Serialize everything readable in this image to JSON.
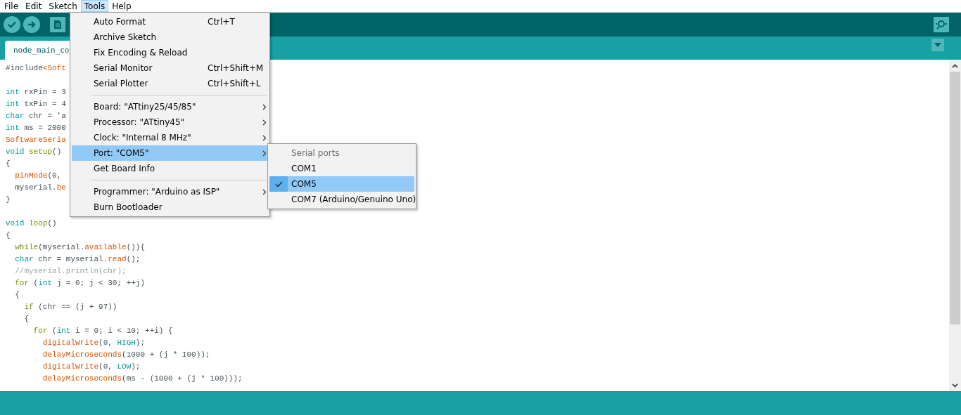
{
  "menubar": [
    {
      "label": "File",
      "selected": false
    },
    {
      "label": "Edit",
      "selected": false
    },
    {
      "label": "Sketch",
      "selected": false
    },
    {
      "label": "Tools",
      "selected": true
    },
    {
      "label": "Help",
      "selected": false
    }
  ],
  "tabs": [
    {
      "label": "node_main_co",
      "selected": true
    }
  ],
  "editor": {
    "lines": [
      {
        "kind": "code",
        "segments": [
          {
            "text": "#include",
            "kind": "plain"
          },
          {
            "text": "<Soft",
            "kind": "func"
          }
        ]
      },
      {
        "kind": "blank"
      },
      {
        "kind": "code",
        "segments": [
          {
            "text": "int",
            "kind": "type"
          },
          {
            "text": " rxPin = 3",
            "kind": "plain"
          }
        ]
      },
      {
        "kind": "code",
        "segments": [
          {
            "text": "int",
            "kind": "type"
          },
          {
            "text": " txPin = 4",
            "kind": "plain"
          }
        ]
      },
      {
        "kind": "code",
        "segments": [
          {
            "text": "char",
            "kind": "type"
          },
          {
            "text": " chr = 'a",
            "kind": "plain"
          }
        ]
      },
      {
        "kind": "code",
        "segments": [
          {
            "text": "int",
            "kind": "type"
          },
          {
            "text": " ms = 2000",
            "kind": "plain"
          }
        ]
      },
      {
        "kind": "code",
        "segments": [
          {
            "text": "SoftwareSeria",
            "kind": "func"
          }
        ]
      },
      {
        "kind": "code",
        "segments": [
          {
            "text": "void ",
            "kind": "type"
          },
          {
            "text": "setup",
            "kind": "kw"
          },
          {
            "text": "()",
            "kind": "plain"
          }
        ]
      },
      {
        "kind": "code",
        "segments": [
          {
            "text": "{",
            "kind": "plain"
          }
        ]
      },
      {
        "kind": "code",
        "segments": [
          {
            "text": "  pinMode",
            "kind": "func"
          },
          {
            "text": "(0,",
            "kind": "plain"
          }
        ]
      },
      {
        "kind": "code",
        "segments": [
          {
            "text": "  myserial.",
            "kind": "plain"
          },
          {
            "text": "be",
            "kind": "func"
          }
        ]
      },
      {
        "kind": "code",
        "segments": [
          {
            "text": "}",
            "kind": "plain"
          }
        ]
      },
      {
        "kind": "blank"
      },
      {
        "kind": "code",
        "segments": [
          {
            "text": "void ",
            "kind": "type"
          },
          {
            "text": "loop",
            "kind": "kw"
          },
          {
            "text": "()",
            "kind": "plain"
          }
        ]
      },
      {
        "kind": "code",
        "segments": [
          {
            "text": "{",
            "kind": "plain"
          }
        ]
      },
      {
        "kind": "code",
        "segments": [
          {
            "text": "  while",
            "kind": "kw"
          },
          {
            "text": "(myserial.",
            "kind": "plain"
          },
          {
            "text": "available",
            "kind": "func"
          },
          {
            "text": "()){",
            "kind": "plain"
          }
        ]
      },
      {
        "kind": "code",
        "segments": [
          {
            "text": "  char",
            "kind": "type"
          },
          {
            "text": " chr = myserial.",
            "kind": "plain"
          },
          {
            "text": "read",
            "kind": "func"
          },
          {
            "text": "();",
            "kind": "plain"
          }
        ]
      },
      {
        "kind": "code",
        "segments": [
          {
            "text": "  //myserial.println(chr);",
            "kind": "comment"
          }
        ]
      },
      {
        "kind": "code",
        "segments": [
          {
            "text": "  for",
            "kind": "kw"
          },
          {
            "text": " (",
            "kind": "plain"
          },
          {
            "text": "int",
            "kind": "type"
          },
          {
            "text": " j = 0; j < 30; ++j)",
            "kind": "plain"
          }
        ]
      },
      {
        "kind": "code",
        "segments": [
          {
            "text": "  {",
            "kind": "plain"
          }
        ]
      },
      {
        "kind": "code",
        "segments": [
          {
            "text": "    if",
            "kind": "kw"
          },
          {
            "text": " (chr == (j + 97))",
            "kind": "plain"
          }
        ]
      },
      {
        "kind": "code",
        "segments": [
          {
            "text": "    {",
            "kind": "plain"
          }
        ]
      },
      {
        "kind": "code",
        "segments": [
          {
            "text": "      for",
            "kind": "kw"
          },
          {
            "text": " (",
            "kind": "plain"
          },
          {
            "text": "int",
            "kind": "type"
          },
          {
            "text": " i = 0; i < 10; ++i) {",
            "kind": "plain"
          }
        ]
      },
      {
        "kind": "code",
        "segments": [
          {
            "text": "        digitalWrite",
            "kind": "func"
          },
          {
            "text": "(0, ",
            "kind": "plain"
          },
          {
            "text": "HIGH",
            "kind": "type"
          },
          {
            "text": ");",
            "kind": "plain"
          }
        ]
      },
      {
        "kind": "code",
        "segments": [
          {
            "text": "        delayMicroseconds",
            "kind": "func"
          },
          {
            "text": "(1000 + (j * 100));",
            "kind": "plain"
          }
        ]
      },
      {
        "kind": "code",
        "segments": [
          {
            "text": "        digitalWrite",
            "kind": "func"
          },
          {
            "text": "(0, ",
            "kind": "plain"
          },
          {
            "text": "LOW",
            "kind": "type"
          },
          {
            "text": ");",
            "kind": "plain"
          }
        ]
      },
      {
        "kind": "code",
        "segments": [
          {
            "text": "        delayMicroseconds",
            "kind": "func"
          },
          {
            "text": "(ms - (1000 + (j * 100)));",
            "kind": "plain"
          }
        ]
      }
    ]
  },
  "tools_menu": {
    "items": [
      {
        "kind": "item",
        "label": "Auto Format",
        "shortcut": "Ctrl+T",
        "submenu": false,
        "selected": false
      },
      {
        "kind": "item",
        "label": "Archive Sketch",
        "submenu": false,
        "selected": false
      },
      {
        "kind": "item",
        "label": "Fix Encoding & Reload",
        "submenu": false,
        "selected": false
      },
      {
        "kind": "item",
        "label": "Serial Monitor",
        "shortcut": "Ctrl+Shift+M",
        "submenu": false,
        "selected": false
      },
      {
        "kind": "item",
        "label": "Serial Plotter",
        "shortcut": "Ctrl+Shift+L",
        "submenu": false,
        "selected": false
      },
      {
        "kind": "separator"
      },
      {
        "kind": "item",
        "label": "Board: \"ATtiny25/45/85\"",
        "submenu": true,
        "selected": false
      },
      {
        "kind": "item",
        "label": "Processor: \"ATtiny45\"",
        "submenu": true,
        "selected": false
      },
      {
        "kind": "item",
        "label": "Clock: \"Internal 8 MHz\"",
        "submenu": true,
        "selected": false
      },
      {
        "kind": "item",
        "label": "Port: \"COM5\"",
        "submenu": true,
        "selected": true
      },
      {
        "kind": "item",
        "label": "Get Board Info",
        "submenu": false,
        "selected": false
      },
      {
        "kind": "separator"
      },
      {
        "kind": "item",
        "label": "Programmer: \"Arduino as ISP\"",
        "submenu": true,
        "selected": false
      },
      {
        "kind": "item",
        "label": "Burn Bootloader",
        "submenu": false,
        "selected": false
      }
    ]
  },
  "port_submenu": {
    "header": "Serial ports",
    "items": [
      {
        "label": "COM1",
        "checked": false,
        "selected": false
      },
      {
        "label": "COM5",
        "checked": true,
        "selected": true
      },
      {
        "label": "COM7 (Arduino/Genuino Uno)",
        "checked": false,
        "selected": false
      }
    ]
  }
}
